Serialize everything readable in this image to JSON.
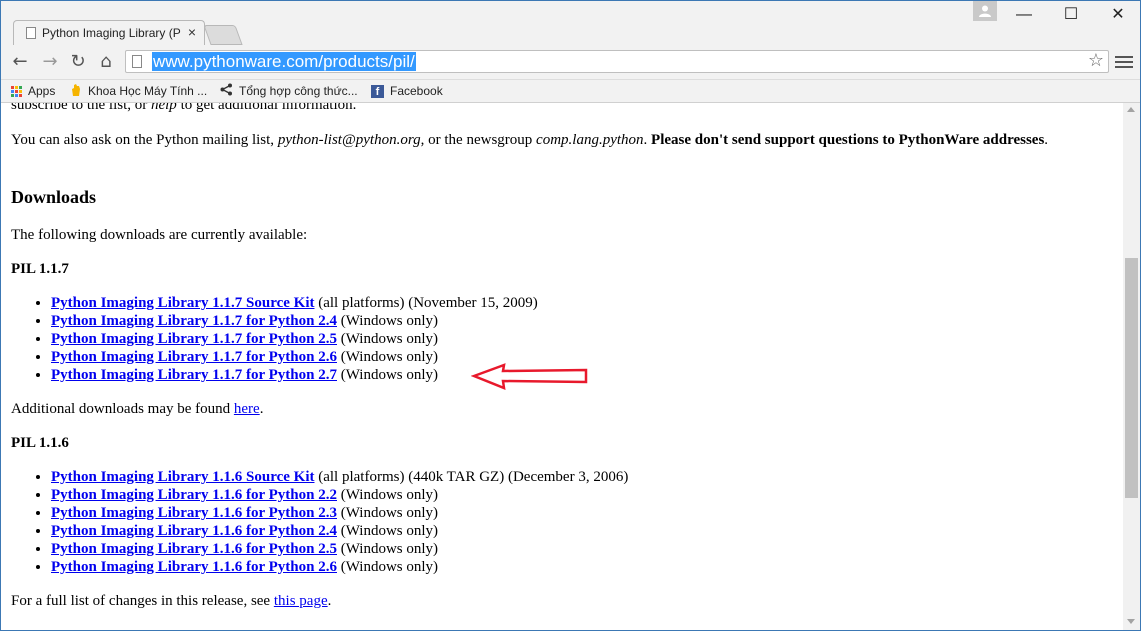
{
  "browser": {
    "tab_title": "Python Imaging Library (P",
    "tab_close": "×",
    "url": "www.pythonware.com/products/pil/",
    "window_controls": {
      "minimize": "—",
      "maximize": "☐",
      "close": "✕"
    },
    "nav": {
      "back": "←",
      "forward": "→",
      "reload": "↻",
      "home": "⌂"
    },
    "star": "☆",
    "bookmarks": [
      {
        "label": "Apps",
        "icon": "apps-grid-icon"
      },
      {
        "label": "Khoa Học Máy Tính ...",
        "icon": "hand-icon"
      },
      {
        "label": "Tổng hợp công thức...",
        "icon": "share-icon"
      },
      {
        "label": "Facebook",
        "icon": "facebook-icon"
      }
    ]
  },
  "page": {
    "cutoff_line": {
      "pre": "subscribe to the list, or ",
      "help": "help",
      "post": " to get additional information."
    },
    "mailing": {
      "prefix": "You can also ask on the Python mailing list, ",
      "email": "python-list@python.org",
      "mid": ", or the newsgroup ",
      "newsgroup": "comp.lang.python",
      "post": ". ",
      "bold": "Please don't send support questions to PythonWare addresses",
      "end": "."
    },
    "downloads_heading": "Downloads",
    "intro": "The following downloads are currently available:",
    "pil117": {
      "heading": "PIL 1.1.7",
      "items": [
        {
          "link": "Python Imaging Library 1.1.7 Source Kit",
          "note": " (all platforms) (November 15, 2009)"
        },
        {
          "link": "Python Imaging Library 1.1.7 for Python 2.4",
          "note": " (Windows only)"
        },
        {
          "link": "Python Imaging Library 1.1.7 for Python 2.5",
          "note": " (Windows only)"
        },
        {
          "link": "Python Imaging Library 1.1.7 for Python 2.6",
          "note": " (Windows only)"
        },
        {
          "link": "Python Imaging Library 1.1.7 for Python 2.7",
          "note": " (Windows only)"
        }
      ]
    },
    "additional": {
      "pre": "Additional downloads may be found ",
      "link": "here",
      "post": "."
    },
    "pil116": {
      "heading": "PIL 1.1.6",
      "items": [
        {
          "link": "Python Imaging Library 1.1.6 Source Kit",
          "note": " (all platforms) (440k TAR GZ) (December 3, 2006)"
        },
        {
          "link": "Python Imaging Library 1.1.6 for Python 2.2",
          "note": " (Windows only)"
        },
        {
          "link": "Python Imaging Library 1.1.6 for Python 2.3",
          "note": " (Windows only)"
        },
        {
          "link": "Python Imaging Library 1.1.6 for Python 2.4",
          "note": " (Windows only)"
        },
        {
          "link": "Python Imaging Library 1.1.6 for Python 2.5",
          "note": " (Windows only)"
        },
        {
          "link": "Python Imaging Library 1.1.6 for Python 2.6",
          "note": " (Windows only)"
        }
      ]
    },
    "changes": {
      "pre": "For a full list of changes in this release, see ",
      "link": "this page",
      "post": "."
    }
  },
  "colors": {
    "link": "#0000ee",
    "arrow": "#e8192c",
    "url_highlight": "#3399ff",
    "window_border": "#3c78b4"
  }
}
